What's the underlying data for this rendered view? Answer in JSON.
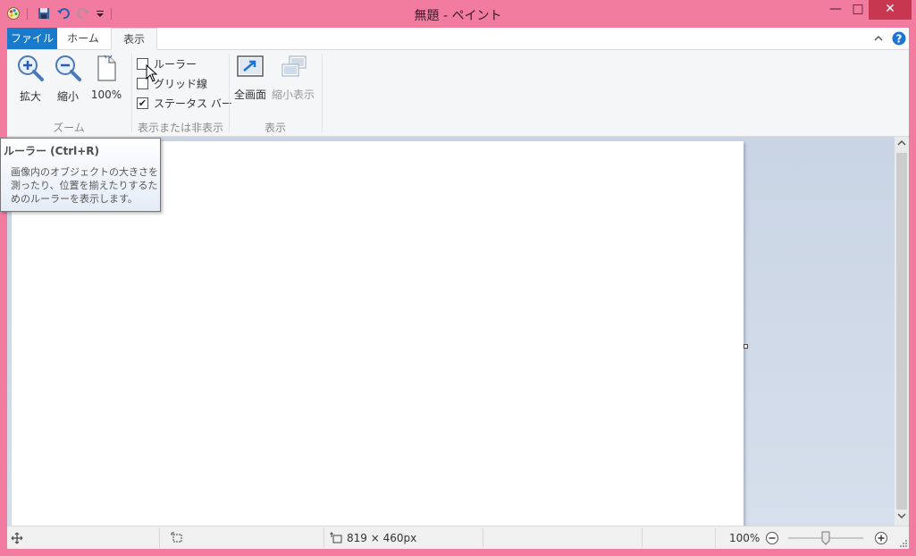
{
  "window": {
    "title": "無題 - ペイント",
    "minimize_glyph": "—",
    "maximize_glyph": "□",
    "close_glyph": "✕"
  },
  "tabs": [
    {
      "label": "ファイル"
    },
    {
      "label": "ホーム"
    },
    {
      "label": "表示"
    }
  ],
  "ribbon": {
    "zoom_group": {
      "label": "ズーム",
      "zoom_in": "拡大",
      "zoom_out": "縮小",
      "actual_size": "100%"
    },
    "showhide_group": {
      "label": "表示または非表示",
      "ruler": {
        "label": "ルーラー",
        "checked": false
      },
      "gridlines": {
        "label": "グリッド線",
        "checked": false
      },
      "statusbar": {
        "label": "ステータス バー",
        "checked": true
      }
    },
    "display_group": {
      "label": "表示",
      "fullscreen": "全画面",
      "thumbnail": "縮小表示"
    }
  },
  "tooltip": {
    "title": "ルーラー (Ctrl+R)",
    "body": "画像内のオブジェクトの大きさを測ったり、位置を揃えたりするためのルーラーを表示します。"
  },
  "status": {
    "canvas_size": "819 × 460px",
    "zoom_level": "100%",
    "zoom_slider_fraction": 0.5
  },
  "colors": {
    "accent": "#1979ca",
    "titlebar": "#f27ba0",
    "close": "#c7374f"
  }
}
